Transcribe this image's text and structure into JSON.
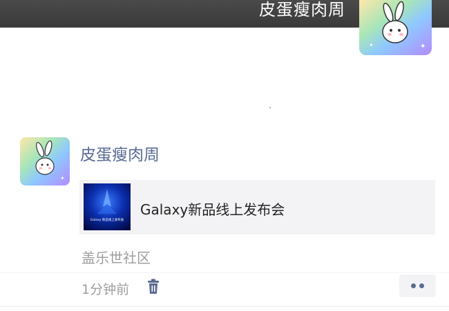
{
  "cover": {
    "nickname": "皮蛋瘦肉周"
  },
  "post": {
    "author": "皮蛋瘦肉周",
    "link": {
      "title": "Galaxy新品线上发布会",
      "thumbnail_text": "Galaxy 新品线上发布会"
    },
    "location": "盖乐世社区",
    "time": "1分钟前",
    "icons": {
      "delete": "trash-icon",
      "more": "more-dots-icon"
    }
  },
  "colors": {
    "nickname_blue": "#576b95",
    "gray_text": "#9e9e9e",
    "card_bg": "#f3f3f5",
    "cover_bar": "#3d3d3d"
  }
}
